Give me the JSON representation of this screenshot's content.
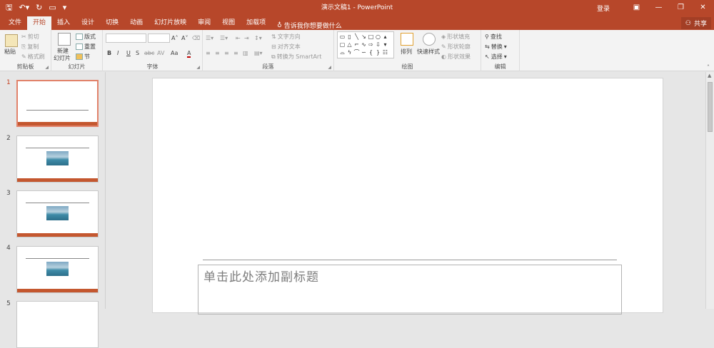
{
  "window": {
    "title": "演示文稿1 - PowerPoint",
    "sign_in": "登录",
    "share": "共享"
  },
  "qat": [
    "save-icon",
    "undo-icon",
    "redo-icon",
    "present-icon",
    "customize-icon"
  ],
  "tabs": [
    "文件",
    "开始",
    "插入",
    "设计",
    "切换",
    "动画",
    "幻灯片放映",
    "审阅",
    "视图",
    "加载项"
  ],
  "active_tab": "开始",
  "tell_me": "告诉我你想要做什么",
  "ribbon": {
    "clipboard": {
      "label": "剪贴板",
      "paste": "粘贴",
      "cut": "剪切",
      "copy": "复制",
      "format_painter": "格式刷"
    },
    "slides": {
      "label": "幻灯片",
      "new_slide_1": "新建",
      "new_slide_2": "幻灯片",
      "layout": "版式",
      "reset": "重置",
      "section": "节"
    },
    "font": {
      "label": "字体",
      "bold": "B",
      "italic": "I",
      "underline": "U",
      "shadow": "S",
      "strike": "abc",
      "spacing": "AV",
      "case": "Aa",
      "color": "A"
    },
    "paragraph": {
      "label": "段落",
      "text_direction": "文字方向",
      "align_text": "对齐文本",
      "smartart": "转换为 SmartArt"
    },
    "drawing": {
      "label": "绘图",
      "arrange": "排列",
      "quick_styles": "快速样式",
      "shape_fill": "形状填充",
      "shape_outline": "形状轮廓",
      "shape_effects": "形状效果"
    },
    "editing": {
      "label": "编辑",
      "find": "查找",
      "replace": "替换",
      "select": "选择"
    }
  },
  "thumbnails": [
    {
      "num": "1",
      "active": true,
      "has_image": false
    },
    {
      "num": "2",
      "active": false,
      "has_image": true
    },
    {
      "num": "3",
      "active": false,
      "has_image": true
    },
    {
      "num": "4",
      "active": false,
      "has_image": true
    },
    {
      "num": "5",
      "active": false,
      "has_image": false
    }
  ],
  "slide": {
    "subtitle_placeholder": "单击此处添加副标题"
  }
}
